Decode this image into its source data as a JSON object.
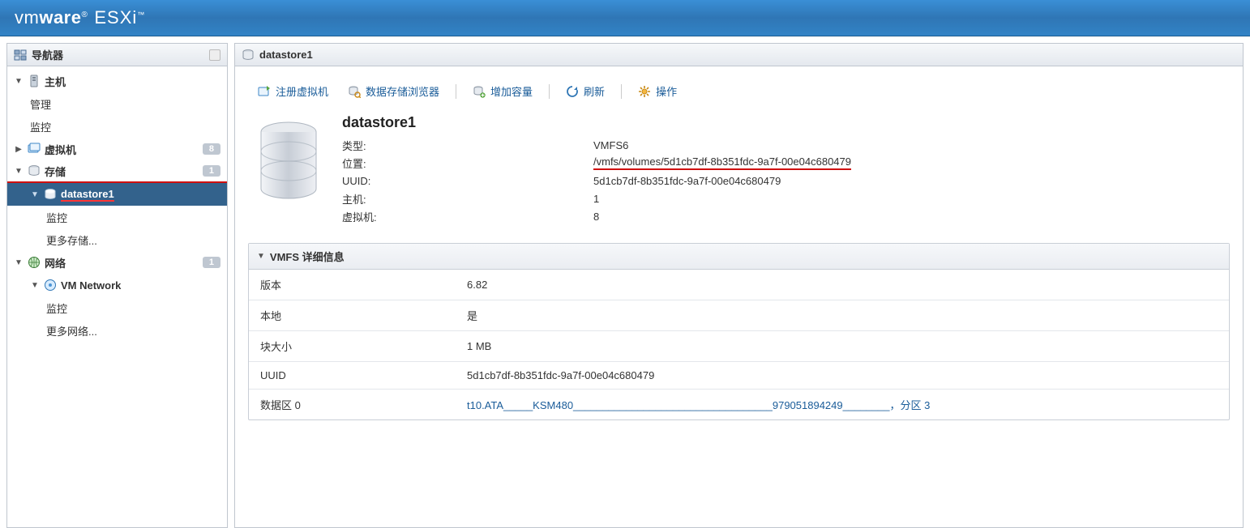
{
  "brand": {
    "name1_a": "vm",
    "name1_b": "ware",
    "reg": "®",
    "name2": "ESXi",
    "tm": "™"
  },
  "sidebar": {
    "title": "导航器",
    "items": [
      {
        "label": "主机",
        "kind": "host",
        "expandable": true
      },
      {
        "label": "管理",
        "kind": "leaf"
      },
      {
        "label": "监控",
        "kind": "leaf"
      },
      {
        "label": "虚拟机",
        "kind": "vm",
        "badge": "8",
        "expandable": true
      },
      {
        "label": "存储",
        "kind": "storage",
        "badge": "1",
        "expandable": true,
        "red": true
      },
      {
        "label": "datastore1",
        "kind": "datastore",
        "selected": true,
        "red": true
      },
      {
        "label": "监控",
        "kind": "leaf"
      },
      {
        "label": "更多存储...",
        "kind": "leaf"
      },
      {
        "label": "网络",
        "kind": "network",
        "badge": "1",
        "expandable": true
      },
      {
        "label": "VM Network",
        "kind": "net",
        "expandable": true
      },
      {
        "label": "监控",
        "kind": "leaf"
      },
      {
        "label": "更多网络...",
        "kind": "leaf"
      }
    ]
  },
  "page": {
    "title": "datastore1",
    "toolbar": {
      "register_vm": "注册虚拟机",
      "browse": "数据存储浏览器",
      "increase": "增加容量",
      "refresh": "刷新",
      "actions": "操作"
    },
    "summary_title": "datastore1",
    "kv": [
      {
        "k": "类型:",
        "v": "VMFS6"
      },
      {
        "k": "位置:",
        "v": "/vmfs/volumes/5d1cb7df-8b351fdc-9a7f-00e04c680479",
        "red": true
      },
      {
        "k": "UUID:",
        "v": "5d1cb7df-8b351fdc-9a7f-00e04c680479"
      },
      {
        "k": "主机:",
        "v": "1"
      },
      {
        "k": "虚拟机:",
        "v": "8"
      }
    ],
    "detail_title": "VMFS 详细信息",
    "details": [
      {
        "k": "版本",
        "v": "6.82"
      },
      {
        "k": "本地",
        "v": "是"
      },
      {
        "k": "块大小",
        "v": "1 MB"
      },
      {
        "k": "UUID",
        "v": "5d1cb7df-8b351fdc-9a7f-00e04c680479"
      },
      {
        "k": "数据区 0",
        "v": "t10.ATA_____KSM480__________________________________979051894249________，分区 3",
        "link": true
      }
    ]
  }
}
